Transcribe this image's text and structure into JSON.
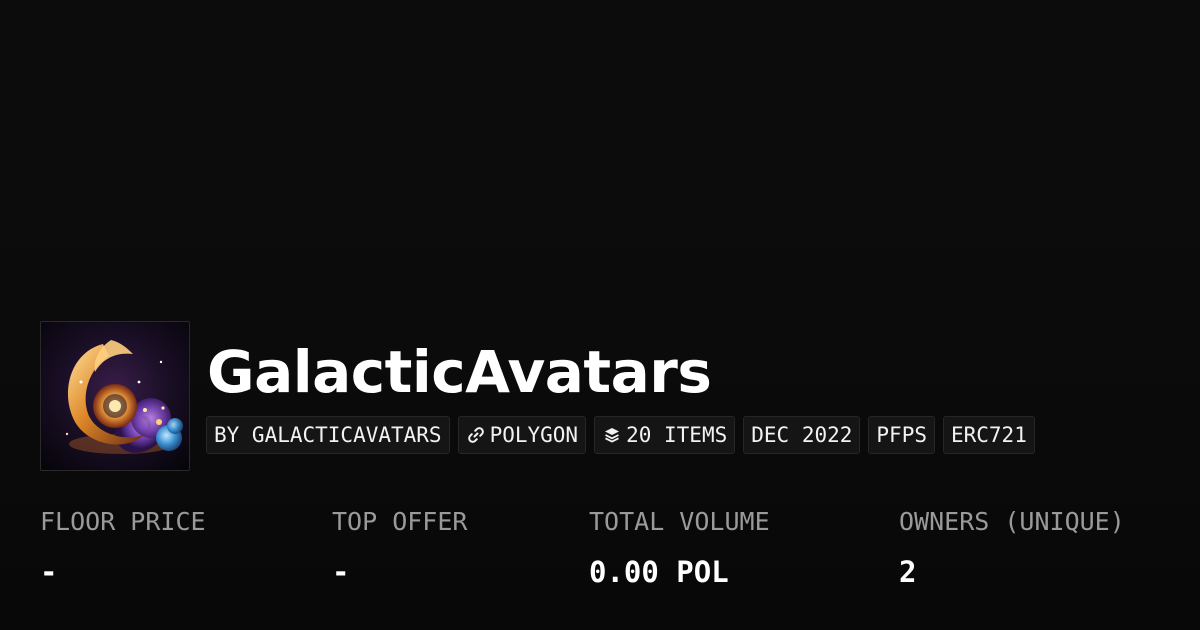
{
  "collection": {
    "title": "GalacticAvatars",
    "avatar_icon": "collection-avatar-image"
  },
  "tags": [
    {
      "label": "BY GALACTICAVATARS"
    },
    {
      "label": "POLYGON",
      "icon": "link-icon"
    },
    {
      "label": "20 ITEMS",
      "icon": "layers-icon"
    },
    {
      "label": "DEC 2022"
    },
    {
      "label": "PFPS"
    },
    {
      "label": "ERC721"
    }
  ],
  "stats": [
    {
      "label": "FLOOR PRICE",
      "value": "-"
    },
    {
      "label": "TOP OFFER",
      "value": "-"
    },
    {
      "label": "TOTAL VOLUME",
      "value": "0.00 POL"
    },
    {
      "label": "OWNERS (UNIQUE)",
      "value": "2"
    }
  ],
  "colors": {
    "background": "#0b0b0b",
    "tag_background": "#151515",
    "tag_border": "#262626",
    "label_gray": "#9a9a9a",
    "text": "#ffffff"
  }
}
